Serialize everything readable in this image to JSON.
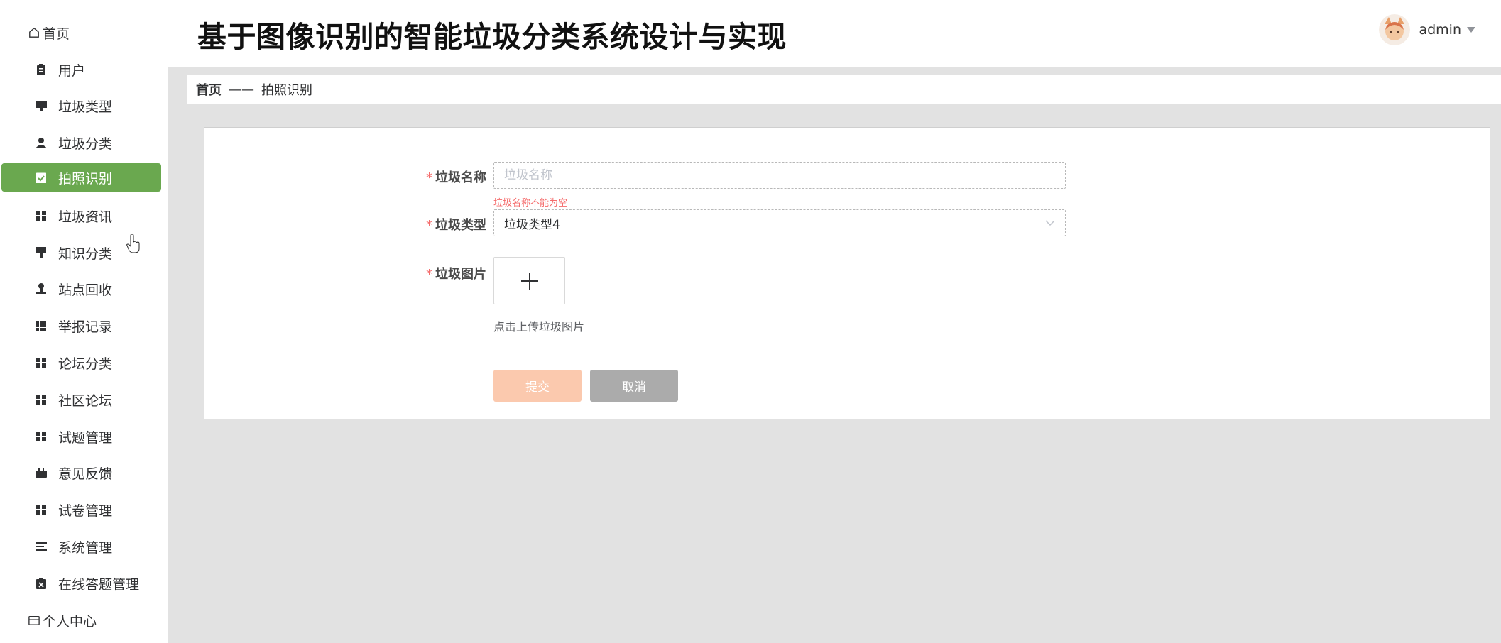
{
  "app": {
    "title": "基于图像识别的智能垃圾分类系统设计与实现",
    "accent_color": "#6aa84f",
    "submit_color": "#fbc9ae",
    "cancel_color": "#ababab",
    "error_color": "#f56c6c"
  },
  "user": {
    "name": "admin"
  },
  "sidebar": {
    "home": {
      "label": "首页",
      "icon": "home-icon"
    },
    "items": [
      {
        "label": "用户",
        "icon": "clipboard-icon"
      },
      {
        "label": "垃圾类型",
        "icon": "monitor-icon"
      },
      {
        "label": "垃圾分类",
        "icon": "person-icon"
      },
      {
        "label": "拍照识别",
        "icon": "clipboard-check-icon",
        "active": true
      },
      {
        "label": "垃圾资讯",
        "icon": "grid-icon"
      },
      {
        "label": "知识分类",
        "icon": "brush-icon"
      },
      {
        "label": "站点回收",
        "icon": "stamp-icon"
      },
      {
        "label": "举报记录",
        "icon": "grid-9-icon"
      },
      {
        "label": "论坛分类",
        "icon": "grid-icon"
      },
      {
        "label": "社区论坛",
        "icon": "grid-icon"
      },
      {
        "label": "试题管理",
        "icon": "grid-icon"
      },
      {
        "label": "意见反馈",
        "icon": "briefcase-icon"
      },
      {
        "label": "试卷管理",
        "icon": "grid-icon"
      },
      {
        "label": "系统管理",
        "icon": "list-icon"
      },
      {
        "label": "在线答题管理",
        "icon": "clipboard-x-icon"
      }
    ],
    "personal": {
      "label": "个人中心",
      "icon": "wallet-icon"
    }
  },
  "breadcrumb": {
    "home": "首页",
    "separator": "——",
    "current": "拍照识别"
  },
  "form": {
    "required_mark": "*",
    "name": {
      "label": "垃圾名称",
      "value": "",
      "placeholder": "垃圾名称",
      "error": "垃圾名称不能为空"
    },
    "type": {
      "label": "垃圾类型",
      "value": "垃圾类型4"
    },
    "image": {
      "label": "垃圾图片",
      "upload_symbol": "+",
      "hint": "点击上传垃圾图片"
    },
    "submit_label": "提交",
    "cancel_label": "取消"
  }
}
